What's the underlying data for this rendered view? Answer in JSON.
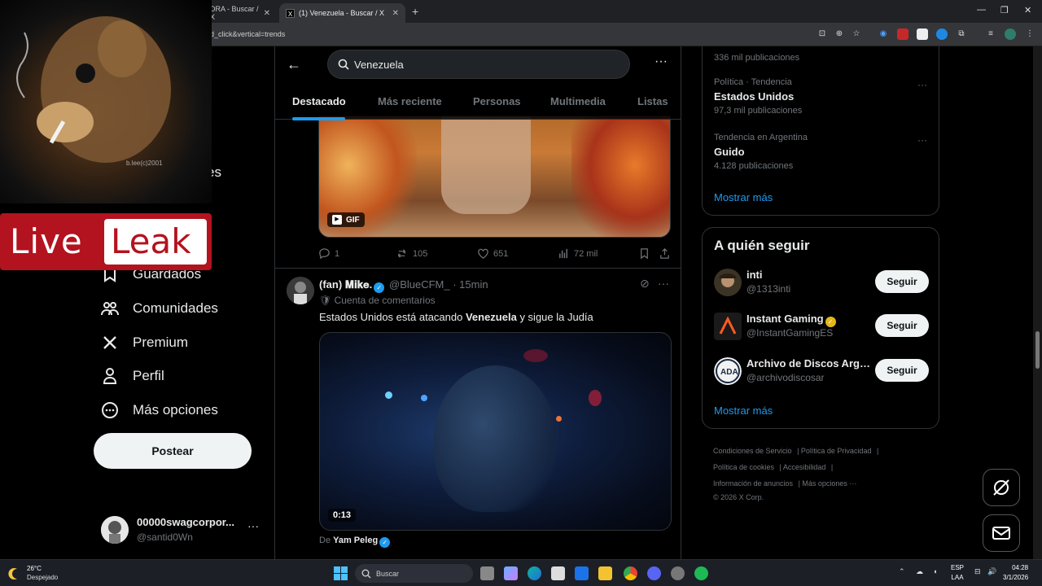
{
  "browser": {
    "tab1_title": "DRA - Buscar / X",
    "tab2_title": "(1) Venezuela - Buscar / X",
    "url": "d_click&vertical=trends"
  },
  "nav": {
    "partial_item": "es",
    "items": [
      {
        "label": "Guardados",
        "icon": "bookmark-icon"
      },
      {
        "label": "Comunidades",
        "icon": "communities-icon"
      },
      {
        "label": "Premium",
        "icon": "x-logo-icon"
      },
      {
        "label": "Perfil",
        "icon": "profile-icon"
      },
      {
        "label": "Más opciones",
        "icon": "more-circle-icon"
      }
    ],
    "post_button": "Postear",
    "account": {
      "name": "00000swagcorpor...",
      "handle": "@santid0Wn"
    }
  },
  "overlay": {
    "live": "Live",
    "leak": "Leak",
    "watermark": "b.lee(c)2001"
  },
  "search": {
    "query": "Venezuela",
    "tabs": [
      "Destacado",
      "Más reciente",
      "Personas",
      "Multimedia",
      "Listas"
    ]
  },
  "tweet1": {
    "gif_label": "GIF",
    "replies": "1",
    "reposts": "105",
    "likes": "651",
    "views": "72 mil"
  },
  "tweet2": {
    "name": "(fan) 𝐌𝐢𝐤𝐞.",
    "handle": "@BlueCFM_",
    "time": "· 15min",
    "community_notes": "Cuenta de comentarios",
    "text_pre": "Estados Unidos está atacando ",
    "text_bold": "Venezuela",
    "text_post": " y sigue la Judía",
    "video_time": "0:13",
    "from_label": "De",
    "from_name": "Yam Peleg"
  },
  "trends": {
    "top_count": "336 mil publicaciones",
    "items": [
      {
        "category": "Política · Tendencia",
        "name": "Estados Unidos",
        "count": "97,3 mil publicaciones"
      },
      {
        "category": "Tendencia en Argentina",
        "name": "Guido",
        "count": "4.128 publicaciones"
      }
    ],
    "show_more": "Mostrar más"
  },
  "who_to_follow": {
    "title": "A quién seguir",
    "users": [
      {
        "name": "inti",
        "handle": "@1313inti",
        "button": "Seguir"
      },
      {
        "name": "Instant Gaming",
        "handle": "@InstantGamingES",
        "button": "Seguir"
      },
      {
        "name": "Archivo de Discos Arge...",
        "handle": "@archivodiscosar",
        "button": "Seguir"
      }
    ],
    "show_more": "Mostrar más"
  },
  "footer": {
    "links": [
      "Condiciones de Servicio",
      "Política de Privacidad",
      "Política de cookies",
      "Accesibilidad",
      "Información de anuncios",
      "Más opciones ···"
    ],
    "copyright": "© 2026 X Corp."
  },
  "taskbar": {
    "temp": "26°C",
    "condition": "Despejado",
    "search_placeholder": "Buscar",
    "lang1": "ESP",
    "lang2": "LAA",
    "time": "04:28",
    "date": "3/1/2026"
  },
  "colors": {
    "accent": "#1d9bf0",
    "liveleak_red": "#b3121f"
  }
}
